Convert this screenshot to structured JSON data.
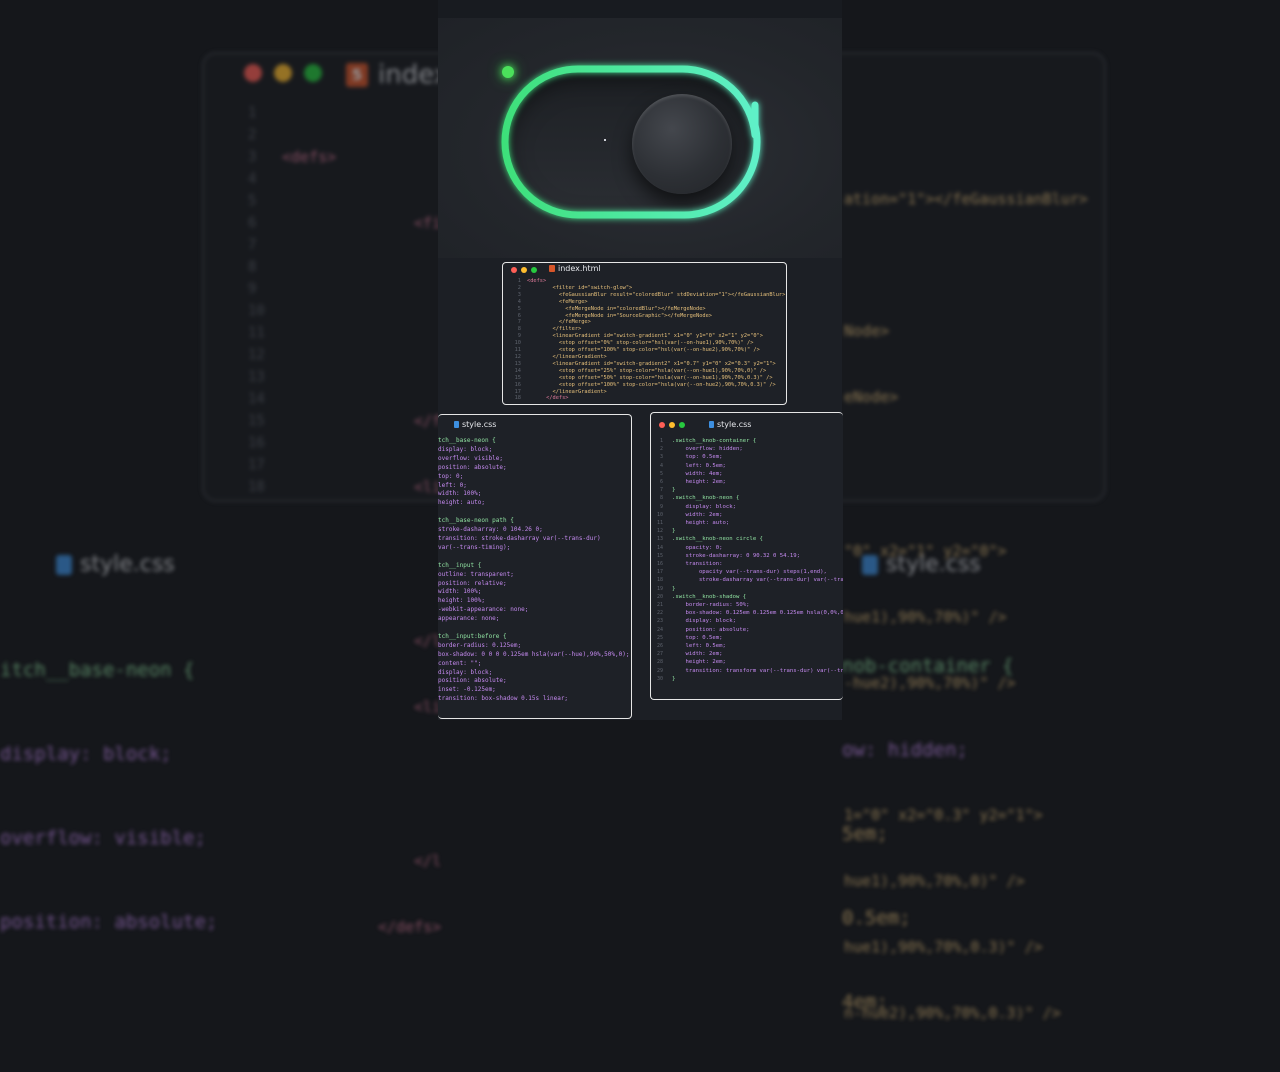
{
  "colors": {
    "neon_start": "#3ee07a",
    "neon_end": "#5ff0c8",
    "led": "#4be05b",
    "dot_red": "#ff5f56",
    "dot_yellow": "#ffbd2e",
    "dot_green": "#27c93f"
  },
  "backdrop": {
    "html_title": "index",
    "html_badge": "5",
    "html_code_left": [
      "<defs>",
      "<fi",
      "</f",
      "<li",
      "</l",
      "<li",
      "</l",
      "</defs>"
    ],
    "html_code_right": [
      "ation=\"1\"></feGaussianBlur>",
      "Node>",
      "eNode>",
      "\"0\" x2=\"1\" y2=\"0\">",
      "hue1),90%,70%)\" />",
      "-hue2),90%,70%)\" />",
      "1=\"0\" x2=\"0.3\" y2=\"1\">",
      "hue1),90%,70%,0)\" />",
      "hue1),90%,70%,0.3)\" />",
      "n-hue2),90%,70%,0.3)\" />"
    ],
    "line_numbers": [
      "1",
      "2",
      "3",
      "4",
      "5",
      "6",
      "7",
      "8",
      "9",
      "10",
      "11",
      "12",
      "13",
      "14",
      "15",
      "16",
      "17",
      "18"
    ],
    "css_title_left": "style.css",
    "css_title_right": "style.css",
    "css_left": [
      "itch__base-neon {",
      "display: block;",
      "overflow: visible;",
      "position: absolute;"
    ],
    "css_right": [
      "nob-container {",
      "ow: hidden;",
      "5em;",
      "0.5em;",
      "4em;"
    ]
  },
  "html_window": {
    "title": "index.html",
    "lines": [
      "<defs>",
      "        <filter id=\"switch-glow\">",
      "          <feGaussianBlur result=\"coloredBlur\" stdDeviation=\"1\"></feGaussianBlur>",
      "          <feMerge>",
      "            <feMergeNode in=\"coloredBlur\"></feMergeNode>",
      "            <feMergeNode in=\"SourceGraphic\"></feMergeNode>",
      "          </feMerge>",
      "        </filter>",
      "        <linearGradient id=\"switch-gradient1\" x1=\"0\" y1=\"0\" x2=\"1\" y2=\"0\">",
      "          <stop offset=\"0%\" stop-color=\"hsl(var(--on-hue1),90%,70%)\" />",
      "          <stop offset=\"100%\" stop-color=\"hsl(var(--on-hue2),90%,70%)\" />",
      "        </linearGradient>",
      "        <linearGradient id=\"switch-gradient2\" x1=\"0.7\" y1=\"0\" x2=\"0.3\" y2=\"1\">",
      "          <stop offset=\"25%\" stop-color=\"hsla(var(--on-hue1),90%,70%,0)\" />",
      "          <stop offset=\"50%\" stop-color=\"hsla(var(--on-hue1),90%,70%,0.3)\" />",
      "          <stop offset=\"100%\" stop-color=\"hsla(var(--on-hue2),90%,70%,0.3)\" />",
      "        </linearGradient>",
      "      </defs>"
    ]
  },
  "css_left_window": {
    "title": "style.css",
    "lines": [
      "tch__base-neon {",
      "display: block;",
      "overflow: visible;",
      "position: absolute;",
      "top: 0;",
      "left: 0;",
      "width: 100%;",
      "height: auto;",
      "",
      "tch__base-neon path {",
      "stroke-dasharray: 0 104.26 0;",
      "transition: stroke-dasharray var(--trans-dur)",
      "var(--trans-timing);",
      "",
      "tch__input {",
      "outline: transparent;",
      "position: relative;",
      "width: 100%;",
      "height: 100%;",
      "-webkit-appearance: none;",
      "appearance: none;",
      "",
      "tch__input:before {",
      "border-radius: 0.125em;",
      "box-shadow: 0 0 0 0.125em hsla(var(--hue),90%,50%,0);",
      "content: \"\";",
      "display: block;",
      "position: absolute;",
      "inset: -0.125em;",
      "transition: box-shadow 0.15s linear;"
    ]
  },
  "css_right_window": {
    "title": "style.css",
    "numbers": [
      "1",
      "2",
      "3",
      "4",
      "5",
      "6",
      "7",
      "8",
      "9",
      "10",
      "11",
      "12",
      "13",
      "14",
      "15",
      "16",
      "17",
      "18",
      "19",
      "20",
      "21",
      "22",
      "23",
      "24",
      "25",
      "26",
      "27",
      "28",
      "29",
      "30"
    ],
    "lines": [
      ".switch__knob-container {",
      "    overflow: hidden;",
      "    top: 0.5em;",
      "    left: 0.5em;",
      "    width: 4em;",
      "    height: 2em;",
      "}",
      ".switch__knob-neon {",
      "    display: block;",
      "    width: 2em;",
      "    height: auto;",
      "}",
      ".switch__knob-neon circle {",
      "    opacity: 0;",
      "    stroke-dasharray: 0 90.32 0 54.19;",
      "    transition:",
      "        opacity var(--trans-dur) steps(1,end),",
      "        stroke-dasharray var(--trans-dur) var(--tra",
      "}",
      ".switch__knob-shadow {",
      "    border-radius: 50%;",
      "    box-shadow: 0.125em 0.125em 0.125em hsla(0,0%,0%",
      "    display: block;",
      "    position: absolute;",
      "    top: 0.5em;",
      "    left: 0.5em;",
      "    width: 2em;",
      "    height: 2em;",
      "    transition: transform var(--trans-dur) var(--tr",
      "}"
    ]
  }
}
